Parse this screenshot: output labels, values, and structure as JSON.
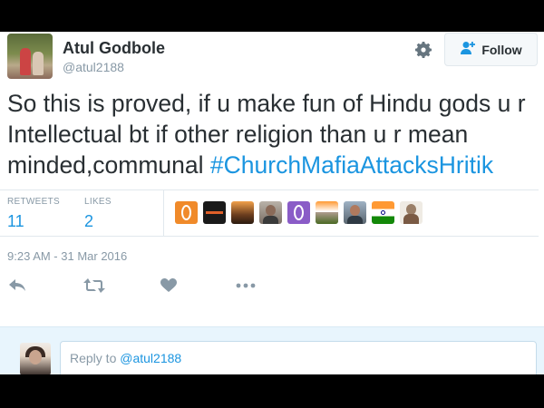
{
  "user": {
    "name": "Atul Godbole",
    "handle": "@atul2188"
  },
  "follow_button": {
    "label": "Follow"
  },
  "tweet": {
    "text": "So this is proved, if u make fun of Hindu gods u r Intellectual bt if other religion than u r mean minded,communal ",
    "hashtag": "#ChurchMafiaAttacksHritik"
  },
  "stats": {
    "retweets_label": "RETWEETS",
    "retweets_count": "11",
    "likes_label": "LIKES",
    "likes_count": "2"
  },
  "likers": [
    {
      "icon": "orange-oval-avatar",
      "color": "#f08a2a"
    },
    {
      "icon": "dark-banner-avatar",
      "color": "#1a1a1a"
    },
    {
      "icon": "sunset-landscape-avatar",
      "color": "#3c2f1e"
    },
    {
      "icon": "person-portrait-avatar",
      "color": "#8c8c8c"
    },
    {
      "icon": "purple-oval-avatar",
      "color": "#8a5cc7"
    },
    {
      "icon": "flag-crowd-avatar",
      "color": "#e07a3a"
    },
    {
      "icon": "man-portrait-avatar",
      "color": "#6a7a8c"
    },
    {
      "icon": "india-flag-avatar",
      "color": "#ff9933"
    },
    {
      "icon": "saint-portrait-avatar",
      "color": "#d8d2c8"
    }
  ],
  "timestamp": "9:23 AM - 31 Mar 2016",
  "actions": [
    {
      "icon": "reply-icon"
    },
    {
      "icon": "retweet-icon"
    },
    {
      "icon": "heart-icon"
    },
    {
      "icon": "more-icon"
    }
  ],
  "reply": {
    "prefix": "Reply to ",
    "mention": "@atul2188"
  },
  "colors": {
    "accent": "#1b95e0",
    "text": "#292f33",
    "muted": "#8899a6",
    "reply_bg": "#e8f5fd"
  }
}
